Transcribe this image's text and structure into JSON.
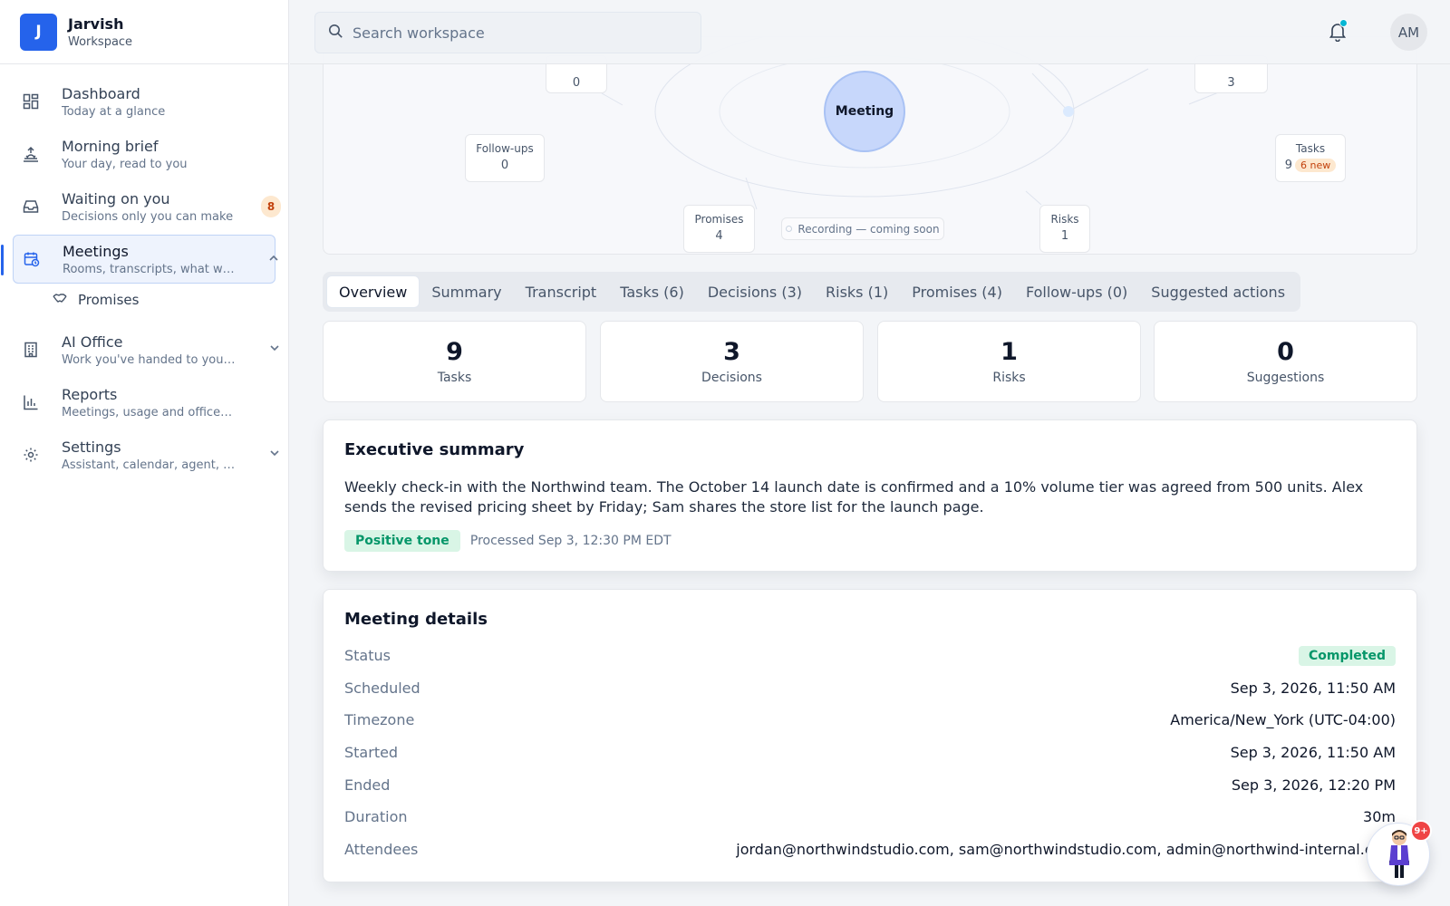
{
  "brand": {
    "initial": "J",
    "name": "Jarvish",
    "subtitle": "Workspace"
  },
  "sidebar": {
    "items": [
      {
        "title": "Dashboard",
        "subtitle": "Today at a glance",
        "icon": "dashboard-icon"
      },
      {
        "title": "Morning brief",
        "subtitle": "Your day, read to you",
        "icon": "sunrise-icon"
      },
      {
        "title": "Waiting on you",
        "subtitle": "Decisions only you can make",
        "icon": "inbox-icon",
        "badge": "8"
      },
      {
        "title": "Meetings",
        "subtitle": "Rooms, transcripts, what was...",
        "icon": "calendar-clock-icon",
        "active": true
      },
      {
        "title": "AI Office",
        "subtitle": "Work you've handed to your ...",
        "icon": "building-icon"
      },
      {
        "title": "Reports",
        "subtitle": "Meetings, usage and office activity",
        "icon": "bar-chart-icon"
      },
      {
        "title": "Settings",
        "subtitle": "Assistant, calendar, agent, bil...",
        "icon": "gear-icon"
      }
    ],
    "subitems": [
      {
        "label": "Promises",
        "icon": "handshake-icon"
      }
    ]
  },
  "topbar": {
    "search_placeholder": "Search workspace",
    "avatar_initials": "AM"
  },
  "graph": {
    "center_label": "Meeting",
    "nodes": {
      "top_left_value": "0",
      "top_right_value": "3",
      "followups": {
        "label": "Follow-ups",
        "value": "0"
      },
      "tasks": {
        "label": "Tasks",
        "value": "9",
        "new_label": "6 new"
      },
      "promises": {
        "label": "Promises",
        "value": "4"
      },
      "risks": {
        "label": "Risks",
        "value": "1"
      }
    },
    "recording_label": "Recording — coming soon"
  },
  "tabs": [
    {
      "label": "Overview",
      "active": true
    },
    {
      "label": "Summary"
    },
    {
      "label": "Transcript"
    },
    {
      "label": "Tasks (6)"
    },
    {
      "label": "Decisions (3)"
    },
    {
      "label": "Risks (1)"
    },
    {
      "label": "Promises (4)"
    },
    {
      "label": "Follow-ups (0)"
    },
    {
      "label": "Suggested actions"
    }
  ],
  "stats": [
    {
      "value": "9",
      "label": "Tasks"
    },
    {
      "value": "3",
      "label": "Decisions"
    },
    {
      "value": "1",
      "label": "Risks"
    },
    {
      "value": "0",
      "label": "Suggestions"
    }
  ],
  "summary": {
    "title": "Executive summary",
    "text": "Weekly check-in with the Northwind team. The October 14 launch date is confirmed and a 10% volume tier was agreed from 500 units. Alex sends the revised pricing sheet by Friday; Sam shares the store list for the launch page.",
    "tone": "Positive tone",
    "processed": "Processed Sep 3, 12:30 PM EDT"
  },
  "details": {
    "title": "Meeting details",
    "rows": [
      {
        "label": "Status",
        "value": "Completed"
      },
      {
        "label": "Scheduled",
        "value": "Sep 3, 2026, 11:50 AM"
      },
      {
        "label": "Timezone",
        "value": "America/New_York (UTC-04:00)"
      },
      {
        "label": "Started",
        "value": "Sep 3, 2026, 11:50 AM"
      },
      {
        "label": "Ended",
        "value": "Sep 3, 2026, 12:20 PM"
      },
      {
        "label": "Duration",
        "value": "30m"
      },
      {
        "label": "Attendees",
        "value": "jordan@northwindstudio.com, sam@northwindstudio.com, admin@northwind-internal.com"
      }
    ]
  },
  "assistant": {
    "badge": "9+"
  },
  "colors": {
    "accent": "#2563eb",
    "success": "#059669",
    "warning": "#c2410c",
    "notify": "#06b6d4",
    "danger": "#ef4444"
  }
}
